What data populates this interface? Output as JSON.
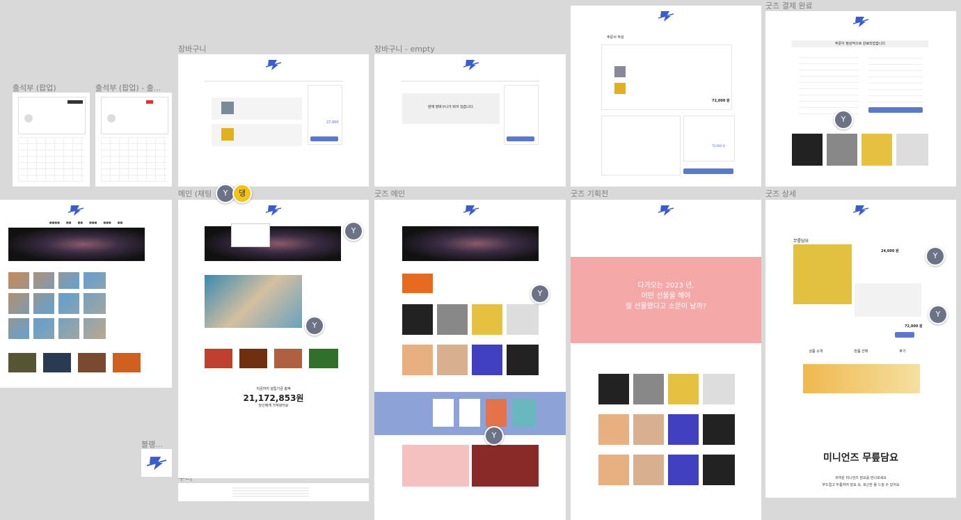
{
  "frames": {
    "attendance": "출석부 (팝업)",
    "attendance_done": "출석부 (팝업) - 출...",
    "cart": "장바구니",
    "cart_empty": "장바구니 - empty",
    "main_chat": "메인 (채팅",
    "goods_main": "굿즈 메인",
    "goods_plan": "굿즈 기획전",
    "goods_detail": "굿즈 상세",
    "goods_pay_done": "굿즈 결제 완료",
    "order": "주문서 작성",
    "footer": "푸터",
    "blank": "블랭..."
  },
  "texts": {
    "cart_empty_msg": "현재 장바구니가 비어 있습니다.",
    "order_title": "주문서 작성",
    "pay_done_msg": "주문이 정상적으로 완료되었습니다",
    "counter_label": "지금까지 설립기금 총액",
    "counter_value": "21,172,853원",
    "counter_sub": "당신에게 가져왔어요",
    "plan_banner_line1": "다가오는 2023 년,",
    "plan_banner_line2": "어떤 선물을 해야",
    "plan_banner_line3": "잘 선물했다고 소문이 날까?",
    "detail_title": "무릎담요",
    "detail_price": "24,000 원",
    "detail_total": "72,000 원",
    "detail_tab1": "상품 소개",
    "detail_tab2": "만품 선택",
    "detail_tab3": "후기",
    "detail_brand": "미니언즈 무릎담요",
    "detail_sub1": "귀여운 미니언즈 담요를 만나보세요",
    "detail_sub2": "부드럽고 두툼하여 담요 속, 포근한 들 느낄 수 있어요",
    "cart_total": "27,000",
    "order_total": "72,000 원",
    "order_pay": "70,000 원"
  },
  "avatars": {
    "y": "Y",
    "dang": "댕"
  }
}
